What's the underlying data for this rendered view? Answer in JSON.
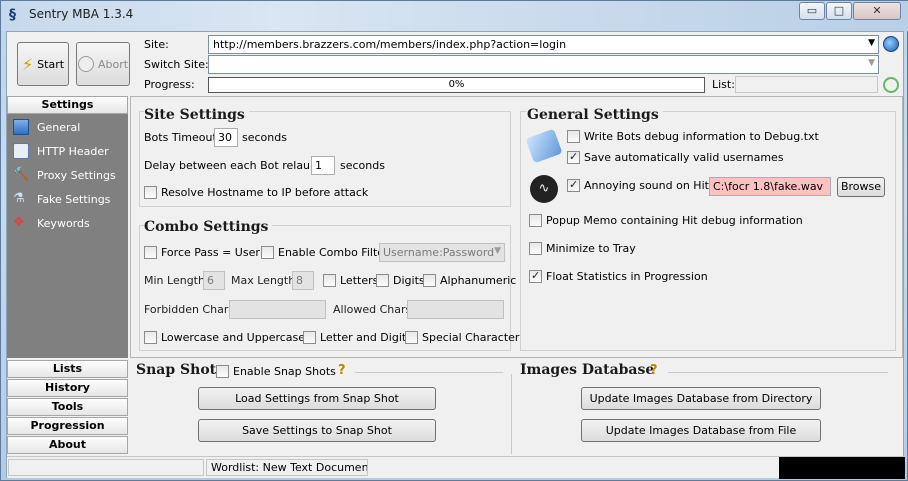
{
  "window": {
    "title": "Sentry MBA 1.3.4",
    "controls": {
      "minimize": "▭",
      "maximize": "□",
      "close": "✕"
    }
  },
  "toolbar": {
    "start_label": "Start",
    "abort_label": "Abort",
    "site_label": "Site:",
    "site_value": "http://members.brazzers.com/members/index.php?action=login",
    "switch_site_label": "Switch Site:",
    "switch_site_value": "",
    "progress_label": "Progress:",
    "progress_text": "0%",
    "progress_value": 0,
    "list_label": "List:",
    "list_value": ""
  },
  "nav": {
    "settings_header": "Settings",
    "items": [
      {
        "label": "General",
        "icon": "general-icon"
      },
      {
        "label": "HTTP Header",
        "icon": "http-header-icon"
      },
      {
        "label": "Proxy Settings",
        "icon": "proxy-icon"
      },
      {
        "label": "Fake Settings",
        "icon": "fake-icon"
      },
      {
        "label": "Keywords",
        "icon": "keywords-icon"
      }
    ],
    "sections": [
      "Lists",
      "History",
      "Tools",
      "Progression",
      "About"
    ]
  },
  "site_settings": {
    "title": "Site Settings",
    "bots_timeout_label": "Bots Timeout:",
    "bots_timeout_value": "30",
    "bots_timeout_unit": "seconds",
    "delay_label": "Delay between each Bot relaunch:",
    "delay_value": "1",
    "delay_unit": "seconds",
    "resolve_label": "Resolve Hostname to IP before attack",
    "resolve_checked": false
  },
  "combo_settings": {
    "title": "Combo Settings",
    "force_pass_label": "Force Pass = User",
    "enable_filter_label": "Enable Combo Filter",
    "filter_select": "Username:Password",
    "min_length_label": "Min Length:",
    "min_length_value": "6",
    "max_length_label": "Max Length:",
    "max_length_value": "8",
    "letters_label": "Letters",
    "digits_label": "Digits",
    "alphanumeric_label": "Alphanumeric",
    "forbidden_label": "Forbidden Chars:",
    "allowed_label": "Allowed Chars:",
    "lower_upper_label": "Lowercase and Uppercase",
    "letter_digit_label": "Letter and Digit",
    "special_char_label": "Special Character"
  },
  "general_settings": {
    "title": "General Settings",
    "write_debug_label": "Write Bots debug information to Debug.txt",
    "write_debug_checked": false,
    "save_valid_label": "Save automatically valid usernames",
    "save_valid_checked": true,
    "sound_label": "Annoying sound on Hit ->",
    "sound_checked": true,
    "sound_path": "C:\\focr 1.8\\fake.wav",
    "browse_label": "Browse",
    "popup_memo_label": "Popup Memo containing Hit debug information",
    "popup_memo_checked": false,
    "minimize_tray_label": "Minimize to Tray",
    "minimize_tray_checked": false,
    "float_stats_label": "Float Statistics in Progression",
    "float_stats_checked": true
  },
  "snapshots": {
    "title": "Snap Shots",
    "enable_label": "Enable Snap Shots",
    "help": "?",
    "load_label": "Load Settings from Snap Shot",
    "save_label": "Save Settings to Snap Shot"
  },
  "images_db": {
    "title": "Images Database",
    "help": "?",
    "update_dir_label": "Update Images Database from Directory",
    "update_file_label": "Update Images Database from File"
  },
  "status": {
    "wordlist": "Wordlist: New Text Documen"
  },
  "colors": {
    "nav_bg": "#808080",
    "sound_path_bg": "#ffc0c0",
    "help_color": "#b8860b"
  }
}
